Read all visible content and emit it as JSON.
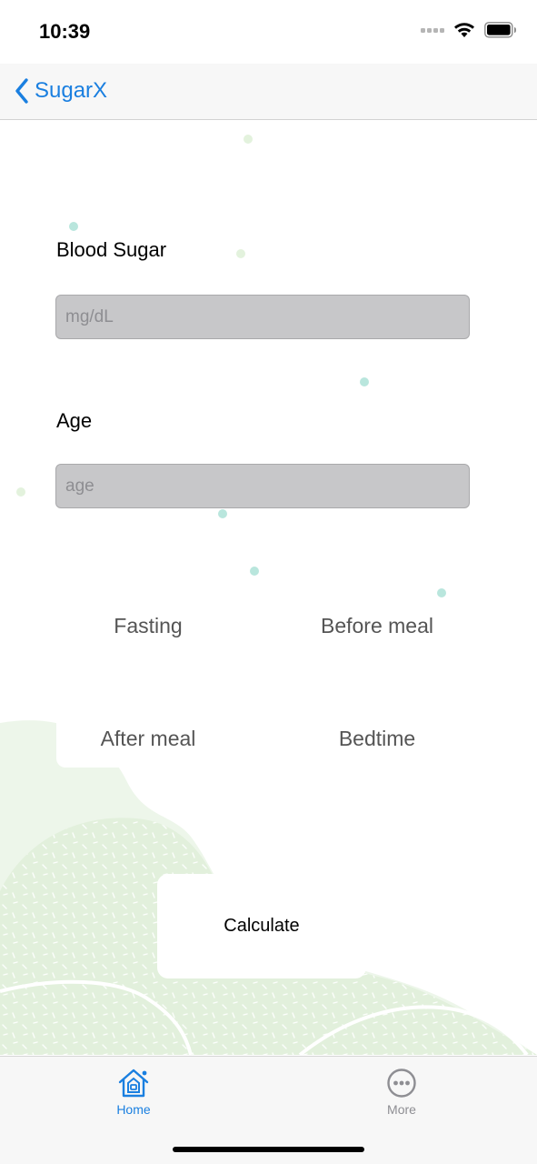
{
  "status_bar": {
    "time": "10:39",
    "icons": [
      "cellular-signal-icon",
      "wifi-icon",
      "battery-icon"
    ]
  },
  "nav": {
    "back_label": "SugarX",
    "back_icon": "chevron-left-icon"
  },
  "form": {
    "blood_sugar": {
      "label": "Blood Sugar",
      "placeholder": "mg/dL",
      "value": ""
    },
    "age": {
      "label": "Age",
      "placeholder": "age",
      "value": ""
    }
  },
  "options": {
    "fasting": "Fasting",
    "before_meal": "Before meal",
    "after_meal": "After meal",
    "bedtime": "Bedtime"
  },
  "calculate_label": "Calculate",
  "tab_bar": {
    "tabs": [
      {
        "label": "Home",
        "icon": "home-icon",
        "selected": true
      },
      {
        "label": "More",
        "icon": "more-icon",
        "selected": false
      }
    ]
  },
  "colors": {
    "accent": "#1a7fe0",
    "field_background": "#c7c7c9",
    "decor_green": "#eaf5e6",
    "decor_dot_teal": "#b5e5dc"
  }
}
